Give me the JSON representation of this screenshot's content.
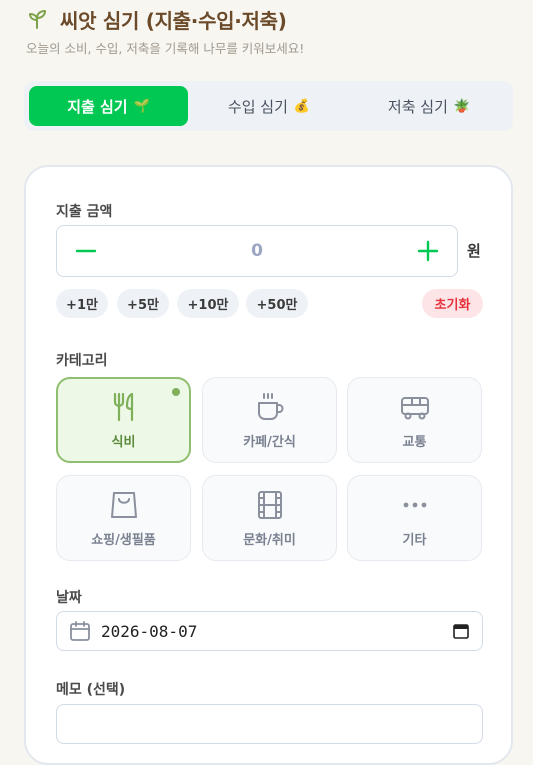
{
  "header": {
    "title": "씨앗 심기 (지출·수입·저축)",
    "subtitle": "오늘의 소비, 수입, 저축을 기록해 나무를 키워보세요!"
  },
  "tabs": [
    {
      "label": "지출 심기",
      "emoji": "🌱",
      "active": true
    },
    {
      "label": "수입 심기",
      "emoji": "💰",
      "active": false
    },
    {
      "label": "저축 심기",
      "emoji": "🪴",
      "active": false
    }
  ],
  "amount": {
    "label": "지출 금액",
    "value": "0",
    "unit": "원"
  },
  "quick_add": [
    "+1만",
    "+5만",
    "+10만",
    "+50만"
  ],
  "reset_label": "초기화",
  "category": {
    "label": "카테고리",
    "items": [
      {
        "label": "식비",
        "icon": "utensils-icon",
        "selected": true
      },
      {
        "label": "카페/간식",
        "icon": "coffee-icon",
        "selected": false
      },
      {
        "label": "교통",
        "icon": "bus-icon",
        "selected": false
      },
      {
        "label": "쇼핑/생필품",
        "icon": "shopping-bag-icon",
        "selected": false
      },
      {
        "label": "문화/취미",
        "icon": "film-icon",
        "selected": false
      },
      {
        "label": "기타",
        "icon": "more-icon",
        "selected": false
      }
    ]
  },
  "date": {
    "label": "날짜",
    "value": "2026-08-07"
  },
  "memo": {
    "label": "메모 (선택)"
  },
  "colors": {
    "accent": "#00c853",
    "brown": "#6b4a2a",
    "selected_border": "#8fbf6e",
    "reset": "#e5323b"
  }
}
